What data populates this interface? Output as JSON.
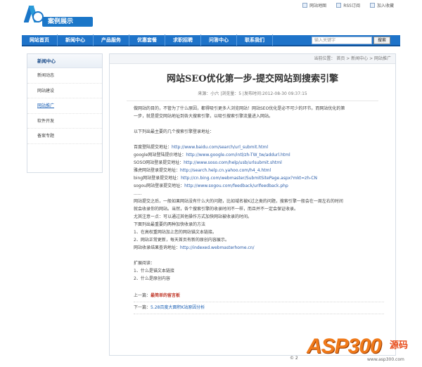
{
  "header": {
    "logo_text": "案例展示",
    "links": [
      "网站地图",
      "RSS订阅",
      "加入收藏"
    ]
  },
  "nav": {
    "items": [
      "网站首页",
      "新闻中心",
      "产品服务",
      "优惠套餐",
      "求职招聘",
      "问答中心",
      "联系我们"
    ],
    "search_placeholder": "输入关键字",
    "search_button": "搜索"
  },
  "sidebar": {
    "heading": "新闻中心",
    "items": [
      "新闻动态",
      "网站建设",
      "网站推广",
      "软件开发",
      "备案专题"
    ],
    "active_index": 2
  },
  "article": {
    "breadcrumb": "当前位置：  首页  >  新闻中心  >  网站推广",
    "title": "网站SEO优化第一步-提交网站到搜索引擎",
    "meta": "来源：小六  |浏览量：5  |发布时间:2012-08-30 09:37:15",
    "intro1": "做网站的目的，不管为了什么原因，都得吸引更多人浏览网站！网站SEO优化是必不可少的环节。而网站优化的第",
    "intro2": "一步，就是提交网站地址到各大搜索引擎，以吸引搜索引擎流量进入网站。",
    "list_heading": "以下列出最主要的几个搜索引擎登录地址：",
    "submits": [
      {
        "label": "百度登陆提交地址：",
        "url": "http://www.baidu.com/search/url_submit.html"
      },
      {
        "label": "google网站登陆提价地址：",
        "url": "http://www.google.com/intl/zh-TW_tw/addurl.html"
      },
      {
        "label": "SOSO网站登录提交地址：",
        "url": "http://www.soso.com/help/usb/urlsubmit.shtml"
      },
      {
        "label": "雅虎网站登录提交地址：",
        "url": "http://search.help.cn.yahoo.com/h4_4.html"
      },
      {
        "label": "bing网站登录提交地址：",
        "url": "http://cn.bing.com/webmaster/SubmitSitePage.aspx?mkt=zh-CN"
      },
      {
        "label": "sogou网站登录提交地址：",
        "url": "http://www.sogou.com/feedback/urlfeedback.php"
      }
    ],
    "ellipsis": "......",
    "para1": "网站提交之后，一般如果网站没有什么大的问题，比如域名被K过之类的问题，搜索引擎一般会在一周左右的时间",
    "para2": "就会收录你的网站。当然，各个搜索引擎的收录时间不一样，而且并不一定会保证收录。",
    "para3": "尤其注意一点：可以通过其他操作方式加快网站被收录的时间。",
    "para4": "下面列出最重要的两种加快收录的方法",
    "tip1": "1、在高权重网站加上您的网站锚文本链接。",
    "tip2": "2、网站正常更新，每天首页有新的原创内容展示。",
    "check_label": "网站收录结果查询地址：",
    "check_url": "http://indexed.webmasterhome.cn/",
    "extended_heading": "扩展阅读：",
    "ext1": "1、什么是锚文本链接",
    "ext2": "2、什么是原创内容",
    "prev_label": "上一篇：",
    "prev_value": "最简单的留言板",
    "next_label": "下一篇：",
    "next_value": "5.28百度大面积K站原因分析"
  },
  "footer": {
    "copyright": "© 2"
  },
  "watermark": {
    "text": "ASP300",
    "side": "源码",
    "url": "www.asp300.com"
  },
  "colors": {
    "nav_bg": "#1e73c9",
    "link": "#2a5ca8",
    "watermark": "#f07a1a"
  }
}
